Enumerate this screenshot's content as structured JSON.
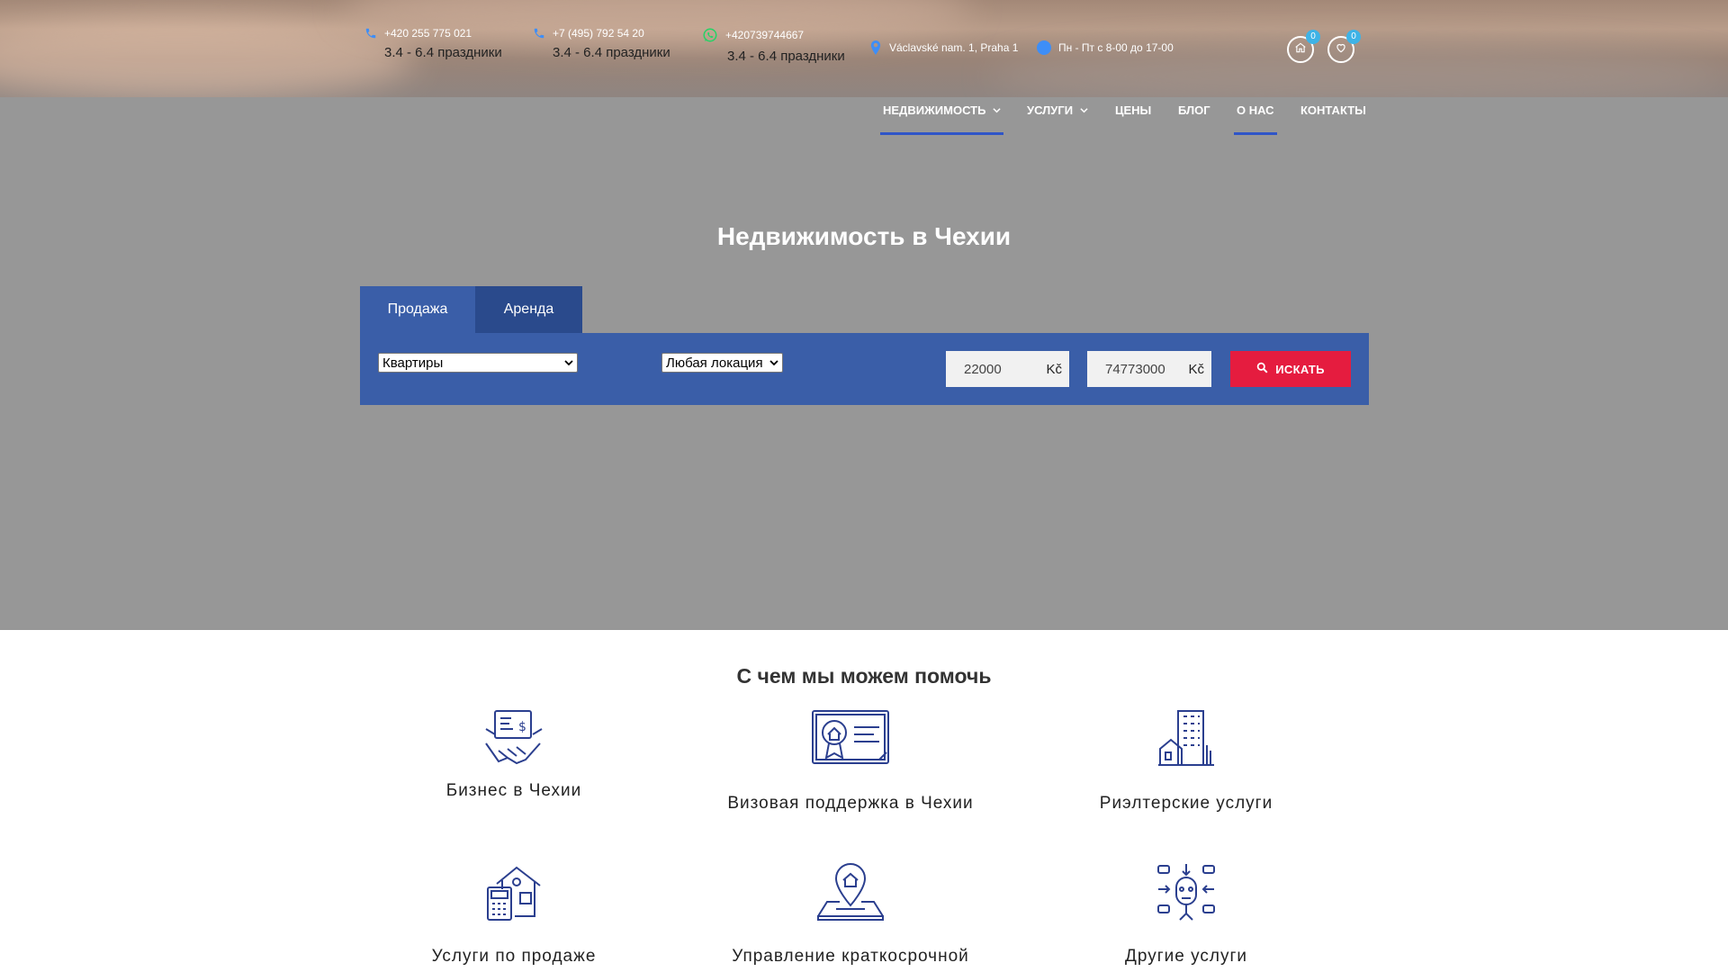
{
  "topbar": {
    "contacts": [
      {
        "phone": "+420 255 775 021",
        "hours": "3.4 - 6.4 праздники",
        "icon": "phone-icon"
      },
      {
        "phone": "+7 (495) 792 54 20",
        "hours": "3.4 - 6.4 праздники",
        "icon": "phone-icon"
      },
      {
        "phone": "+420739744667",
        "hours": "3.4 - 6.4 праздники",
        "icon": "whatsapp-icon"
      }
    ],
    "address": "Václavské nam. 1, Praha 1",
    "schedule": "Пн - Пт с 8-00 до 17-00",
    "compare_count": "0",
    "favorites_count": "0"
  },
  "nav": {
    "items": [
      {
        "label": "НЕДВИЖИМОСТЬ",
        "dropdown": true,
        "active": true
      },
      {
        "label": "УСЛУГИ",
        "dropdown": true,
        "active": false
      },
      {
        "label": "ЦЕНЫ",
        "dropdown": false,
        "active": false
      },
      {
        "label": "БЛОГ",
        "dropdown": false,
        "active": false
      },
      {
        "label": "О НАС",
        "dropdown": false,
        "active": true
      },
      {
        "label": "КОНТАКТЫ",
        "dropdown": false,
        "active": false
      }
    ]
  },
  "hero": {
    "title": "Недвижимость в Чехии"
  },
  "search": {
    "tabs": [
      "Продажа",
      "Аренда"
    ],
    "type_value": "Квартиры",
    "location_value": "Любая локация",
    "price_min": "22000",
    "price_max": "74773000",
    "currency": "Kč",
    "button_label": "ИСКАТЬ"
  },
  "services": {
    "title": "С чем мы можем помочь",
    "items": [
      {
        "label": "Бизнес в Чехии",
        "icon": "business-deal-icon"
      },
      {
        "label": "Визовая поддержка в Чехии",
        "icon": "certificate-icon"
      },
      {
        "label": "Риэлтерские услуги",
        "icon": "buildings-icon"
      },
      {
        "label": "Услуги по продаже",
        "icon": "house-calculator-icon"
      },
      {
        "label": "Управление краткосрочной",
        "icon": "location-house-icon"
      },
      {
        "label": "Другие услуги",
        "icon": "network-icon"
      }
    ]
  },
  "colors": {
    "accent_blue": "#3a5ea8",
    "search_red": "#e51c3f",
    "nav_underline": "#2f55c7",
    "icon_blue": "#2b3f8f"
  }
}
